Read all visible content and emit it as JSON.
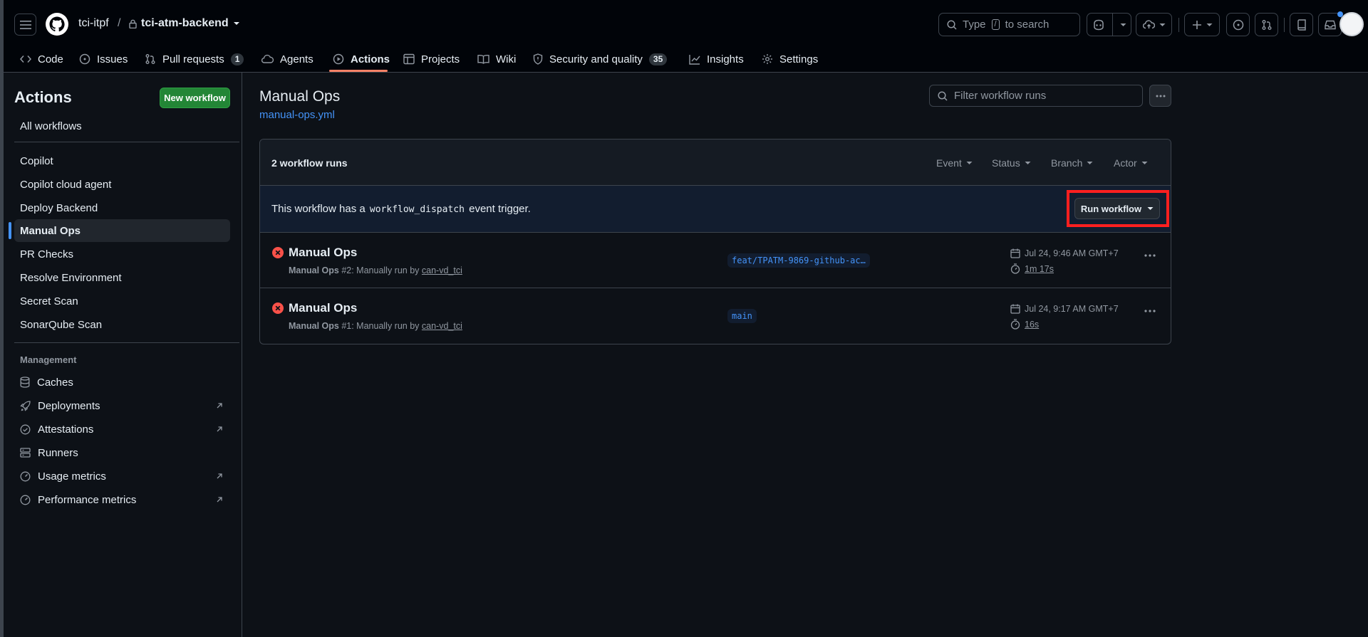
{
  "header": {
    "owner": "tci-itpf",
    "separator": "/",
    "repo": "tci-atm-backend",
    "search": {
      "prefix": "Type",
      "key": "/",
      "suffix": "to search"
    }
  },
  "tabs": [
    {
      "label": "Code",
      "icon": "code-icon"
    },
    {
      "label": "Issues",
      "icon": "issue-opened-icon"
    },
    {
      "label": "Pull requests",
      "icon": "git-pull-request-icon",
      "count": "1"
    },
    {
      "label": "Agents",
      "icon": "agent-icon"
    },
    {
      "label": "Actions",
      "icon": "play-icon",
      "active": true
    },
    {
      "label": "Projects",
      "icon": "table-icon"
    },
    {
      "label": "Wiki",
      "icon": "book-icon"
    },
    {
      "label": "Security and quality",
      "icon": "shield-icon",
      "count": "35"
    },
    {
      "label": "Insights",
      "icon": "graph-icon"
    },
    {
      "label": "Settings",
      "icon": "gear-icon"
    }
  ],
  "sidebar": {
    "title": "Actions",
    "new_workflow": "New workflow",
    "all_workflows": "All workflows",
    "workflows": [
      "Copilot",
      "Copilot cloud agent",
      "Deploy Backend",
      "Manual Ops",
      "PR Checks",
      "Resolve Environment",
      "Secret Scan",
      "SonarQube Scan"
    ],
    "selected": "Manual Ops",
    "management_heading": "Management",
    "management": [
      {
        "label": "Caches",
        "icon": "database-icon"
      },
      {
        "label": "Deployments",
        "icon": "rocket-icon",
        "external": true
      },
      {
        "label": "Attestations",
        "icon": "check-circle-icon",
        "external": true
      },
      {
        "label": "Runners",
        "icon": "server-icon"
      },
      {
        "label": "Usage metrics",
        "icon": "meter-icon",
        "external": true
      },
      {
        "label": "Performance metrics",
        "icon": "meter-icon",
        "external": true
      }
    ]
  },
  "main": {
    "title": "Manual Ops",
    "file": "manual-ops.yml",
    "filter_placeholder": "Filter workflow runs",
    "runs_count": "2 workflow runs",
    "filters": [
      "Event",
      "Status",
      "Branch",
      "Actor"
    ],
    "dispatch": {
      "before": "This workflow has a",
      "code": "workflow_dispatch",
      "after": "event trigger."
    },
    "run_workflow": "Run workflow",
    "runs": [
      {
        "title": "Manual Ops",
        "name": "Manual Ops",
        "number": "#2",
        "trigger": ": Manually run by",
        "actor": "can-vd_tci",
        "branch": "feat/TPATM-9869-github-ac…",
        "date": "Jul 24, 9:46 AM GMT+7",
        "duration": "1m 17s",
        "status": "failure"
      },
      {
        "title": "Manual Ops",
        "name": "Manual Ops",
        "number": "#1",
        "trigger": ": Manually run by",
        "actor": "can-vd_tci",
        "branch": "main",
        "date": "Jul 24, 9:17 AM GMT+7",
        "duration": "16s",
        "status": "failure"
      }
    ]
  },
  "colors": {
    "bg": "#0d1117",
    "header_bg": "#010409",
    "border": "#3d444d",
    "accent": "#4493f8",
    "primary_button": "#238636",
    "danger": "#f85149",
    "tab_underline": "#f78166",
    "highlight": "#ff1f1f"
  }
}
